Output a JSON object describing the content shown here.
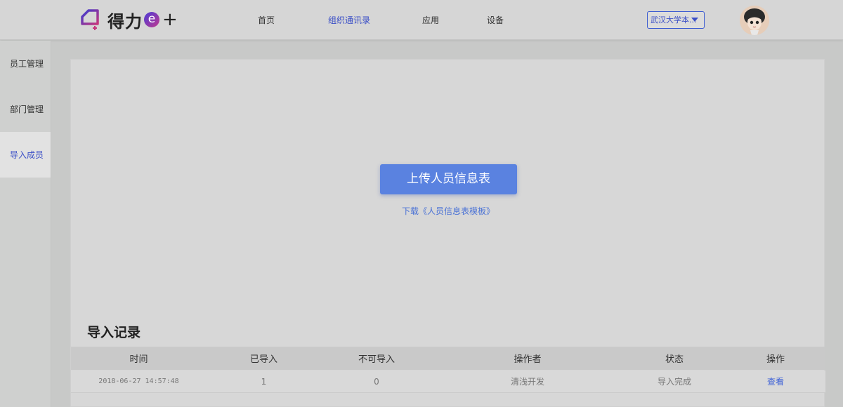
{
  "header": {
    "logo_text": "得力",
    "logo_e": "e",
    "logo_plus": "+",
    "nav": [
      {
        "label": "首页"
      },
      {
        "label": "组织通讯录"
      },
      {
        "label": "应用"
      },
      {
        "label": "设备"
      }
    ],
    "active_nav": "组织通讯录",
    "org_select_value": "武汉大学本...",
    "accent_color": "#3b4fc7"
  },
  "sidebar": {
    "items": [
      {
        "label": "员工管理"
      },
      {
        "label": "部门管理"
      },
      {
        "label": "导入成员"
      }
    ],
    "active_item": "导入成员"
  },
  "main": {
    "upload_button_label": "上传人员信息表",
    "template_link": "下载《人员信息表模板》",
    "records_title": "导入记录",
    "table": {
      "columns": [
        "时间",
        "已导入",
        "不可导入",
        "操作者",
        "状态",
        "操作"
      ],
      "rows": [
        {
          "time": "2018-06-27 14:57:48",
          "imported": "1",
          "not_importable": "0",
          "operator": "清浅开发",
          "status": "导入完成",
          "action": "查看"
        }
      ]
    },
    "button_color": "#5a82e0"
  }
}
